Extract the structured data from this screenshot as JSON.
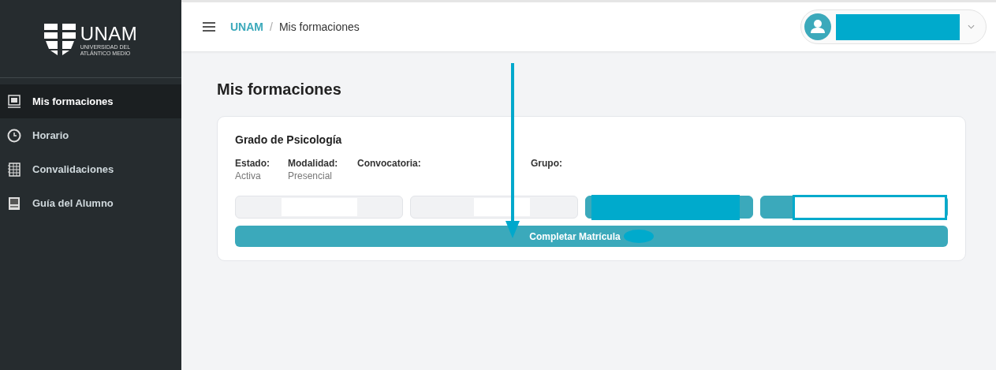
{
  "logo": {
    "name": "UNAM",
    "subtitle_lines": [
      "UNIVERSIDAD DEL",
      "ATLÁNTICO MEDIO"
    ]
  },
  "sidebar": {
    "items": [
      {
        "label": "Mis formaciones",
        "selected": true
      },
      {
        "label": "Horario",
        "selected": false
      },
      {
        "label": "Convalidaciones",
        "selected": false
      },
      {
        "label": "Guía del Alumno",
        "selected": false
      }
    ]
  },
  "breadcrumb": [
    {
      "label": "UNAM",
      "kind": "link"
    },
    {
      "label": "Mis formaciones",
      "kind": "current"
    }
  ],
  "separator": "/",
  "page_title": "Mis formaciones",
  "card": {
    "title": "Grado de Psicología",
    "fields": [
      {
        "label": "Estado:",
        "value": "Activa"
      },
      {
        "label": "Modalidad:",
        "value": "Presencial"
      },
      {
        "label": "Convocatoria:"
      },
      {
        "label": "Grupo:"
      }
    ],
    "buttons": [
      {
        "kind": "secondary"
      },
      {
        "kind": "secondary"
      },
      {
        "kind": "primary"
      },
      {
        "kind": "primary"
      }
    ],
    "main_button": {
      "label": "Completar Matrícula"
    }
  }
}
